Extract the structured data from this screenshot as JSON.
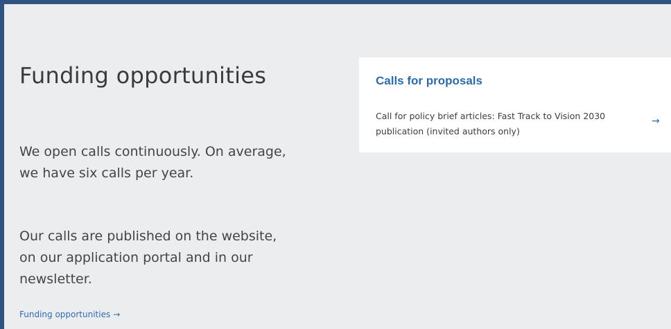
{
  "intro": {
    "heading": "Funding opportunities",
    "paragraphs": [
      "We open calls continuously. On average, we have six calls per year.",
      "Our calls are published on the website, on our application portal and in our newsletter."
    ],
    "link_label": "Funding opportunities",
    "link_icon": "arrow-right-icon"
  },
  "calls_card": {
    "title": "Calls for proposals",
    "items": [
      {
        "label": "Call for policy brief articles: Fast Track to Vision 2030 publication (invited authors only)",
        "icon": "arrow-right-icon"
      }
    ]
  },
  "colors": {
    "frame": "#2f5382",
    "background": "#ecedef",
    "accent": "#2d6aa6",
    "text": "#3a3a3a"
  }
}
